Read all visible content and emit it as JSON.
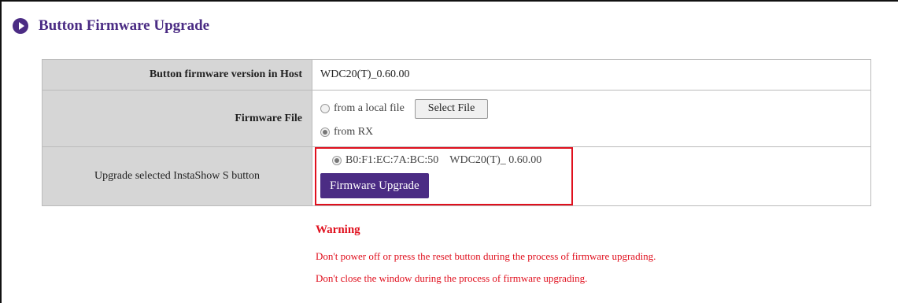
{
  "header": {
    "title": "Button Firmware Upgrade",
    "icon": "play-circle-icon",
    "accent": "#4b2c84"
  },
  "rows": {
    "version": {
      "label": "Button firmware version in Host",
      "value": "WDC20(T)_0.60.00"
    },
    "file": {
      "label": "Firmware File",
      "option_local": "from a local file",
      "select_label": "Select File",
      "option_rx": "from RX",
      "selected": "from RX"
    },
    "upgrade": {
      "label": "Upgrade selected InstaShow S button",
      "device_mac": "B0:F1:EC:7A:BC:50",
      "device_version": "WDC20(T)_ 0.60.00",
      "button_label": "Firmware Upgrade"
    }
  },
  "warning": {
    "title": "Warning",
    "line1": "Don't power off or press the reset button during the process of firmware upgrading.",
    "line2": "Don't close the window during the process of firmware upgrading.",
    "color": "#e0101e"
  }
}
